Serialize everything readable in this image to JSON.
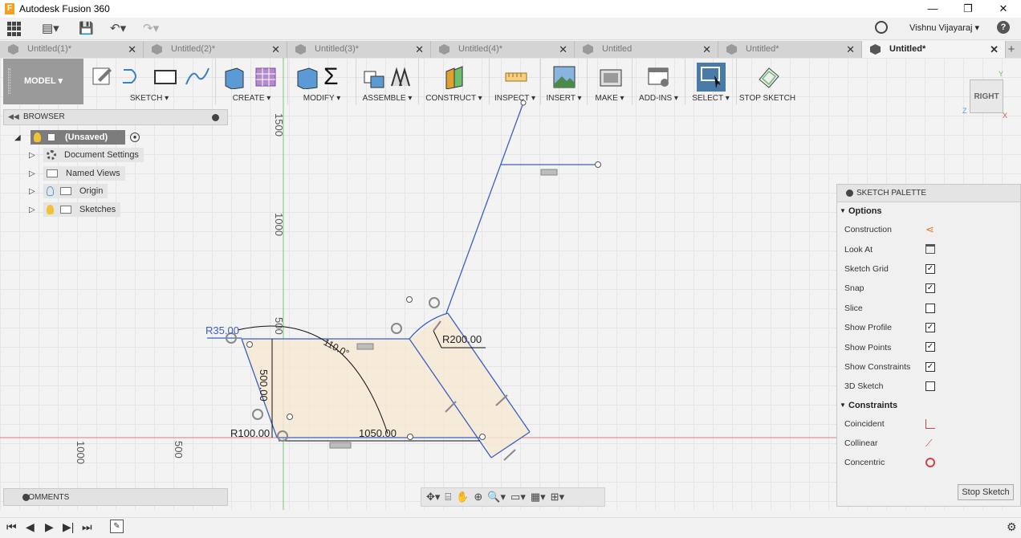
{
  "app": {
    "title": "Autodesk Fusion 360"
  },
  "user": {
    "name": "Vishnu Vijayaraj ▾",
    "help": "?"
  },
  "tabs": [
    {
      "label": "Untitled(1)*",
      "close": "✕"
    },
    {
      "label": "Untitled(2)*",
      "close": "✕"
    },
    {
      "label": "Untitled(3)*",
      "close": "✕"
    },
    {
      "label": "Untitled(4)*",
      "close": "✕"
    },
    {
      "label": "Untitled",
      "close": "✕"
    },
    {
      "label": "Untitled*",
      "close": "✕"
    },
    {
      "label": "Untitled*",
      "close": "✕"
    }
  ],
  "toolbar": {
    "workspace": "MODEL ▾",
    "groups": [
      "SKETCH ▾",
      "CREATE ▾",
      "MODIFY ▾",
      "ASSEMBLE ▾",
      "CONSTRUCT ▾",
      "INSPECT ▾",
      "INSERT ▾",
      "MAKE ▾",
      "ADD-INS ▾",
      "SELECT ▾",
      "STOP SKETCH"
    ]
  },
  "browser": {
    "title": "BROWSER",
    "root": "(Unsaved)",
    "items": [
      "Document Settings",
      "Named Views",
      "Origin",
      "Sketches"
    ]
  },
  "palette": {
    "title": "SKETCH PALETTE",
    "options_header": "Options",
    "options": [
      {
        "label": "Construction",
        "control": "icon",
        "icon": "construction-icon"
      },
      {
        "label": "Look At",
        "control": "icon",
        "icon": "look-at-icon"
      },
      {
        "label": "Sketch Grid",
        "control": "checkbox",
        "checked": true
      },
      {
        "label": "Snap",
        "control": "checkbox",
        "checked": true
      },
      {
        "label": "Slice",
        "control": "checkbox",
        "checked": false
      },
      {
        "label": "Show Profile",
        "control": "checkbox",
        "checked": true
      },
      {
        "label": "Show Points",
        "control": "checkbox",
        "checked": true
      },
      {
        "label": "Show Constraints",
        "control": "checkbox",
        "checked": true
      },
      {
        "label": "3D Sketch",
        "control": "checkbox",
        "checked": false
      }
    ],
    "constraints_header": "Constraints",
    "constraints": [
      {
        "label": "Coincident",
        "icon": "coincident-icon"
      },
      {
        "label": "Collinear",
        "icon": "collinear-icon"
      },
      {
        "label": "Concentric",
        "icon": "concentric-icon"
      }
    ],
    "stop_button": "Stop Sketch"
  },
  "comments": {
    "title": "COMMENTS"
  },
  "viewcube": {
    "face": "RIGHT",
    "axis_y": "Y",
    "axis_z": "Z",
    "axis_x": "X"
  },
  "axis_labels": {
    "v1500": "1500",
    "v1000": "1000",
    "v500": "500",
    "h1000": "1000",
    "h500": "500"
  },
  "dimensions": {
    "r35": "R35.00",
    "r200": "R200.00",
    "angle": "110.0°",
    "r100": "R100.00",
    "len1050": "1050.00",
    "vert500": "500.00"
  },
  "colors": {
    "sketch_line": "#3b5fc4",
    "profile_fill": "#f6e7d4",
    "x_axis": "#d9534f",
    "y_axis": "#5cb85c",
    "select_active": "#4a7aa8"
  }
}
